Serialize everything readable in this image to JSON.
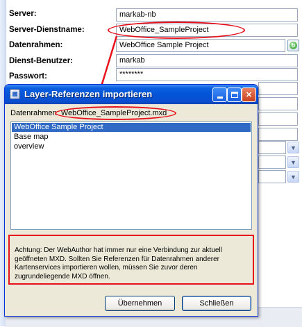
{
  "properties": {
    "server": {
      "label": "Server:",
      "value": "markab-nb"
    },
    "service_name": {
      "label": "Server-Dienstname:",
      "value": "WebOffice_SampleProject"
    },
    "dataframe": {
      "label": "Datenrahmen:",
      "value": "WebOffice Sample Project"
    },
    "service_user": {
      "label": "Dienst-Benutzer:",
      "value": "markab"
    },
    "password": {
      "label": "Passwort:",
      "value": "********"
    }
  },
  "dialog": {
    "title": "Layer-Referenzen importieren",
    "dataframe_label": "Datenrahmen:",
    "dataframe_value": "WebOffice_SampleProject.mxd",
    "list_items": [
      "WebOffice Sample Project",
      "Base map",
      "overview"
    ],
    "selected_index": 0,
    "warning": "Achtung: Der WebAuthor hat immer nur eine Verbindung zur aktuell geöffneten MXD. Sollten Sie Referenzen für Datenrahmen anderer Kartenservices importieren wollen, müssen Sie zuvor deren zugrundeliegende MXD öffnen.",
    "buttons": {
      "accept": "Übernehmen",
      "close": "Schließen"
    }
  },
  "icons": {
    "title": "layers-window-icon",
    "refresh": "refresh-icon",
    "dropdown": "chevron-down-icon"
  },
  "colors": {
    "highlight": "#e8111b",
    "titlebar": "#0453d6",
    "selection": "#316ac5"
  }
}
